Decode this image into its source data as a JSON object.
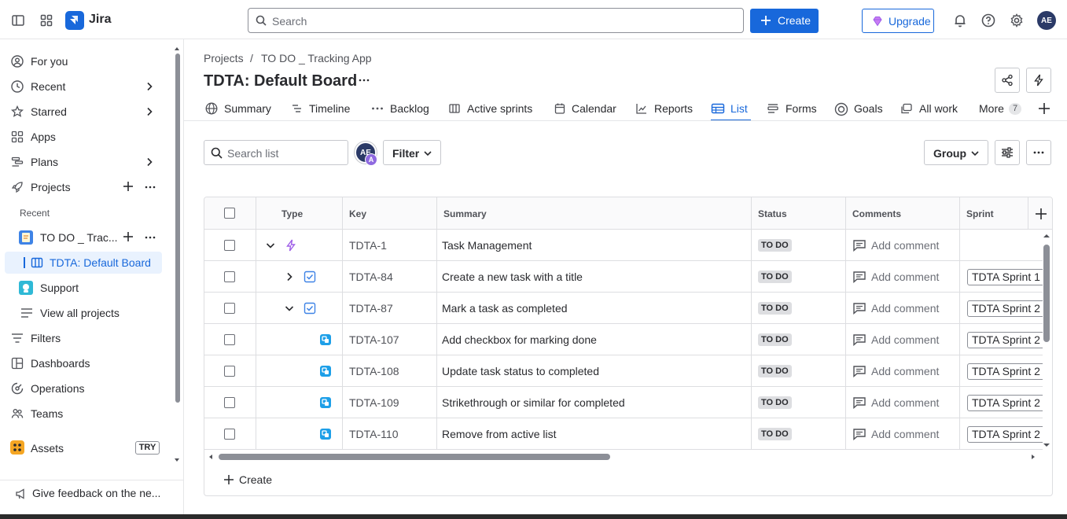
{
  "app": {
    "name": "Jira"
  },
  "topbar": {
    "search_placeholder": "Search",
    "create_label": "Create",
    "upgrade_label": "Upgrade",
    "avatar_initials": "AE"
  },
  "sidebar": {
    "for_you": "For you",
    "recent": "Recent",
    "starred": "Starred",
    "apps": "Apps",
    "plans": "Plans",
    "projects": "Projects",
    "recent_section": "Recent",
    "project_todo": "TO DO _ Trac...",
    "board": "TDTA: Default Board",
    "support": "Support",
    "view_all": "View all projects",
    "filters": "Filters",
    "dashboards": "Dashboards",
    "operations": "Operations",
    "teams": "Teams",
    "assets": "Assets",
    "assets_badge": "TRY",
    "feedback": "Give feedback on the ne..."
  },
  "breadcrumb": {
    "projects": "Projects",
    "separator": "/",
    "project": "TO DO _ Tracking App"
  },
  "board_title": "TDTA: Default Board",
  "tabs": [
    {
      "label": "Summary"
    },
    {
      "label": "Timeline"
    },
    {
      "label": "Backlog"
    },
    {
      "label": "Active sprints"
    },
    {
      "label": "Calendar"
    },
    {
      "label": "Reports"
    },
    {
      "label": "List"
    },
    {
      "label": "Forms"
    },
    {
      "label": "Goals"
    },
    {
      "label": "All work"
    },
    {
      "label": "More",
      "badge": "7"
    }
  ],
  "toolbar": {
    "search_placeholder": "Search list",
    "avatar_initials": "AE",
    "avatar_sub": "A",
    "filter_label": "Filter",
    "group_label": "Group"
  },
  "table": {
    "columns": {
      "type": "Type",
      "key": "Key",
      "summary": "Summary",
      "status": "Status",
      "comments": "Comments",
      "sprint": "Sprint"
    },
    "rows": [
      {
        "key": "TDTA-1",
        "summary": "Task Management",
        "status": "TO DO",
        "comment": "Add comment",
        "sprint": "",
        "issue_type": "epic",
        "expand": "expanded"
      },
      {
        "key": "TDTA-84",
        "summary": "Create a new task with a title",
        "status": "TO DO",
        "comment": "Add comment",
        "sprint": "TDTA Sprint 1",
        "issue_type": "story",
        "expand": "collapsed"
      },
      {
        "key": "TDTA-87",
        "summary": "Mark a task as completed",
        "status": "TO DO",
        "comment": "Add comment",
        "sprint": "TDTA Sprint 2",
        "issue_type": "story",
        "expand": "expanded"
      },
      {
        "key": "TDTA-107",
        "summary": "Add checkbox for marking done",
        "status": "TO DO",
        "comment": "Add comment",
        "sprint": "TDTA Sprint 2",
        "issue_type": "subtask",
        "expand": "none"
      },
      {
        "key": "TDTA-108",
        "summary": "Update task status to completed",
        "status": "TO DO",
        "comment": "Add comment",
        "sprint": "TDTA Sprint 2",
        "issue_type": "subtask",
        "expand": "none"
      },
      {
        "key": "TDTA-109",
        "summary": "Strikethrough or similar for completed",
        "status": "TO DO",
        "comment": "Add comment",
        "sprint": "TDTA Sprint 2",
        "issue_type": "subtask",
        "expand": "none"
      },
      {
        "key": "TDTA-110",
        "summary": "Remove from active list",
        "status": "TO DO",
        "comment": "Add comment",
        "sprint": "TDTA Sprint 2",
        "issue_type": "subtask",
        "expand": "none"
      }
    ],
    "create_label": "Create"
  },
  "colors": {
    "accent": "#1868db",
    "subtask": "#1d9fe8",
    "epic": "#9f5fe8",
    "story": "#3e83e6"
  }
}
